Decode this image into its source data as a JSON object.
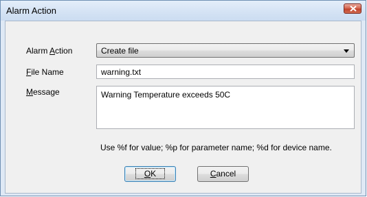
{
  "window": {
    "title": "Alarm Action"
  },
  "form": {
    "alarm_action": {
      "label_pre": "Alarm ",
      "label_key": "A",
      "label_post": "ction",
      "value": "Create file"
    },
    "file_name": {
      "label_key": "F",
      "label_post": "ile Name",
      "value": "warning.txt"
    },
    "message": {
      "label_key": "M",
      "label_post": "essage",
      "value": "Warning Temperature exceeds 50C"
    },
    "hint": "Use %f for value; %p for parameter name; %d for device name."
  },
  "buttons": {
    "ok": {
      "key": "O",
      "rest": "K"
    },
    "cancel": {
      "key": "C",
      "rest": "ancel"
    }
  },
  "colors": {
    "titlebar": "#d6e4f5",
    "client": "#f0f0f0",
    "close": "#c2442d"
  },
  "icons": {
    "close": "close-icon",
    "dropdown": "chevron-down-icon"
  }
}
